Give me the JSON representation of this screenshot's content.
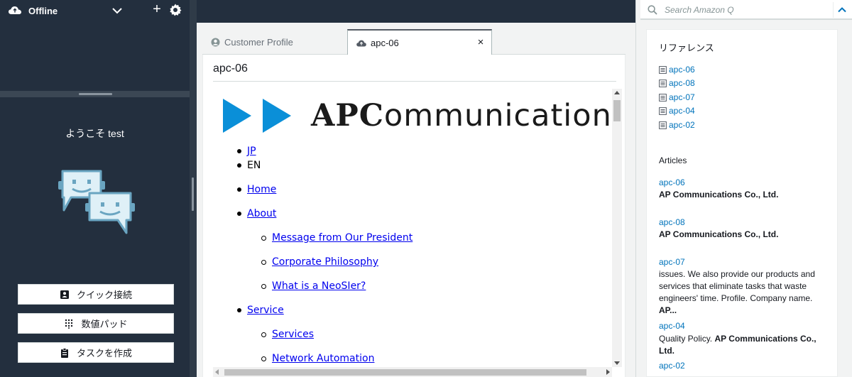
{
  "ccp": {
    "status": "Offline",
    "welcome": "ようこそ test",
    "buttons": {
      "quick_connect": "クイック接続",
      "number_pad": "数値パッド",
      "create_task": "タスクを作成"
    }
  },
  "tabs": [
    {
      "label": "Customer Profile"
    },
    {
      "label": "apc-06"
    }
  ],
  "content": {
    "title": "apc-06",
    "logo_text": "APCommunications",
    "nav": {
      "jp": "JP",
      "en": "EN",
      "home": "Home",
      "about": "About",
      "message": "Message from Our President",
      "philosophy": "Corporate Philosophy",
      "neosier": "What is a NeoSIer?",
      "service": "Service",
      "services": "Services",
      "network_automation": "Network Automation"
    }
  },
  "amazon_q": {
    "search_placeholder": "Search Amazon Q",
    "references_title": "リファレンス",
    "references": [
      "apc-06",
      "apc-08",
      "apc-07",
      "apc-04",
      "apc-02"
    ],
    "articles_title": "Articles",
    "articles": [
      {
        "title": "apc-06",
        "excerpt_bold": "AP Communications Co., Ltd."
      },
      {
        "title": "apc-08",
        "excerpt_bold": "AP Communications Co., Ltd."
      },
      {
        "title": "apc-07",
        "excerpt": "issues. We also provide our products and services that eliminate tasks that waste engineers' time. Profile. Company name.",
        "excerpt_bold": "AP..."
      },
      {
        "title": "apc-04",
        "excerpt": "Quality Policy.",
        "excerpt_bold": "AP Communications Co., Ltd."
      },
      {
        "title": "apc-02"
      }
    ]
  },
  "colors": {
    "ccp_background": "#232f3e",
    "link_blue": "#0073bb",
    "logo_blue": "#0a8fd8",
    "bot_blue": "#6aa5c1"
  }
}
